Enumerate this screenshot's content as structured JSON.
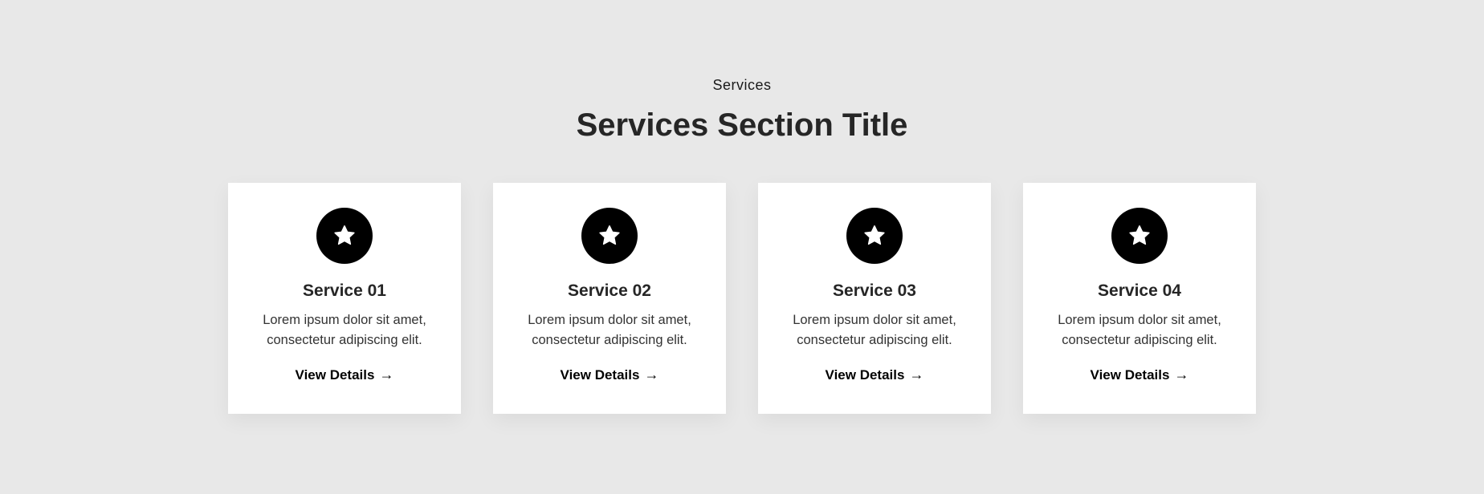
{
  "section": {
    "eyebrow": "Services",
    "title": "Services Section Title"
  },
  "cards": [
    {
      "icon": "star-icon",
      "title": "Service 01",
      "description": "Lorem ipsum dolor sit amet, consectetur adipiscing elit.",
      "link": "View Details",
      "link_arrow": "→"
    },
    {
      "icon": "star-icon",
      "title": "Service 02",
      "description": "Lorem ipsum dolor sit amet, consectetur adipiscing elit.",
      "link": "View Details",
      "link_arrow": "→"
    },
    {
      "icon": "star-icon",
      "title": "Service 03",
      "description": "Lorem ipsum dolor sit amet, consectetur adipiscing elit.",
      "link": "View Details",
      "link_arrow": "→"
    },
    {
      "icon": "star-icon",
      "title": "Service 04",
      "description": "Lorem ipsum dolor sit amet, consectetur adipiscing elit.",
      "link": "View Details",
      "link_arrow": "→"
    }
  ],
  "colors": {
    "background": "#e8e8e8",
    "card": "#ffffff",
    "icon_bg": "#000000",
    "icon_fg": "#ffffff",
    "heading": "#262626"
  }
}
